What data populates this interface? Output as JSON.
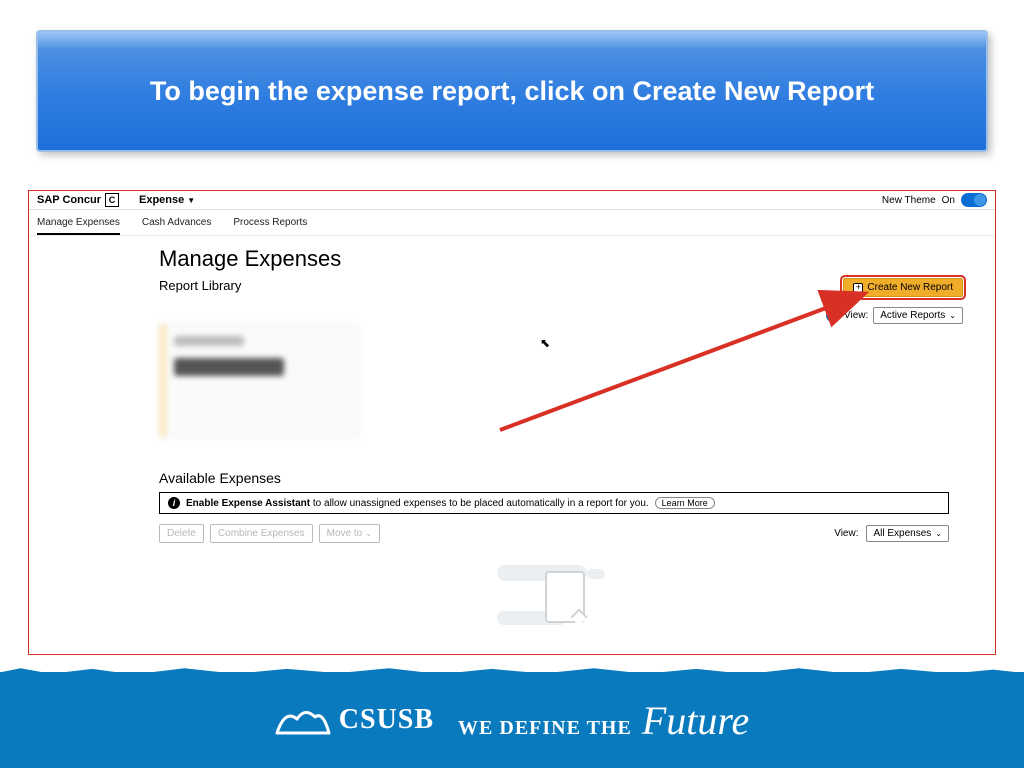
{
  "banner": {
    "text": "To begin the expense report, click on Create New Report"
  },
  "app": {
    "brand": "SAP Concur",
    "brand_badge": "C",
    "menu_label": "Expense",
    "theme_label": "New Theme",
    "theme_state": "On"
  },
  "subnav": {
    "tab1": "Manage Expenses",
    "tab2": "Cash Advances",
    "tab3": "Process Reports"
  },
  "page": {
    "title": "Manage Expenses",
    "section1": "Report Library",
    "create_btn": "Create New Report",
    "view_label": "View:",
    "view_select": "Active Reports",
    "section2": "Available Expenses",
    "assistant_strong": "Enable Expense Assistant",
    "assistant_rest": " to allow unassigned expenses to be placed automatically in a report for you. ",
    "learn_more": "Learn More",
    "btn_delete": "Delete",
    "btn_combine": "Combine Expenses",
    "btn_moveto": "Move to",
    "view2_label": "View:",
    "view2_select": "All Expenses"
  },
  "footer": {
    "org": "CSUSB",
    "tagline_caps": "WE DEFINE THE",
    "tagline_script": "Future"
  }
}
